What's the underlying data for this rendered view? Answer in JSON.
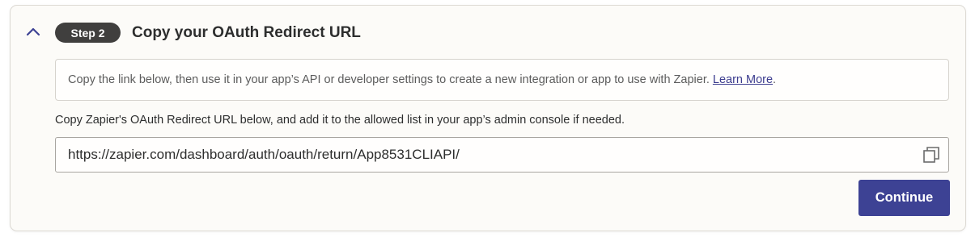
{
  "step": {
    "badge": "Step 2",
    "title": "Copy your OAuth Redirect URL",
    "collapse_icon": "chevron-up-icon"
  },
  "info": {
    "text": "Copy the link below, then use it in your app’s API or developer settings to create a new integration or app to use with Zapier.",
    "link_label": "Learn More",
    "trailing": "."
  },
  "instruction": "Copy Zapier's OAuth Redirect URL below, and add it to the allowed list in your app’s admin console if needed.",
  "redirect_url": {
    "value": "https://zapier.com/dashboard/auth/oauth/return/App8531CLIAPI/",
    "copy_icon": "copy-icon"
  },
  "actions": {
    "continue_label": "Continue"
  },
  "colors": {
    "accent": "#3d4294",
    "badge_bg": "#403f3e",
    "link": "#3d3d8f"
  }
}
